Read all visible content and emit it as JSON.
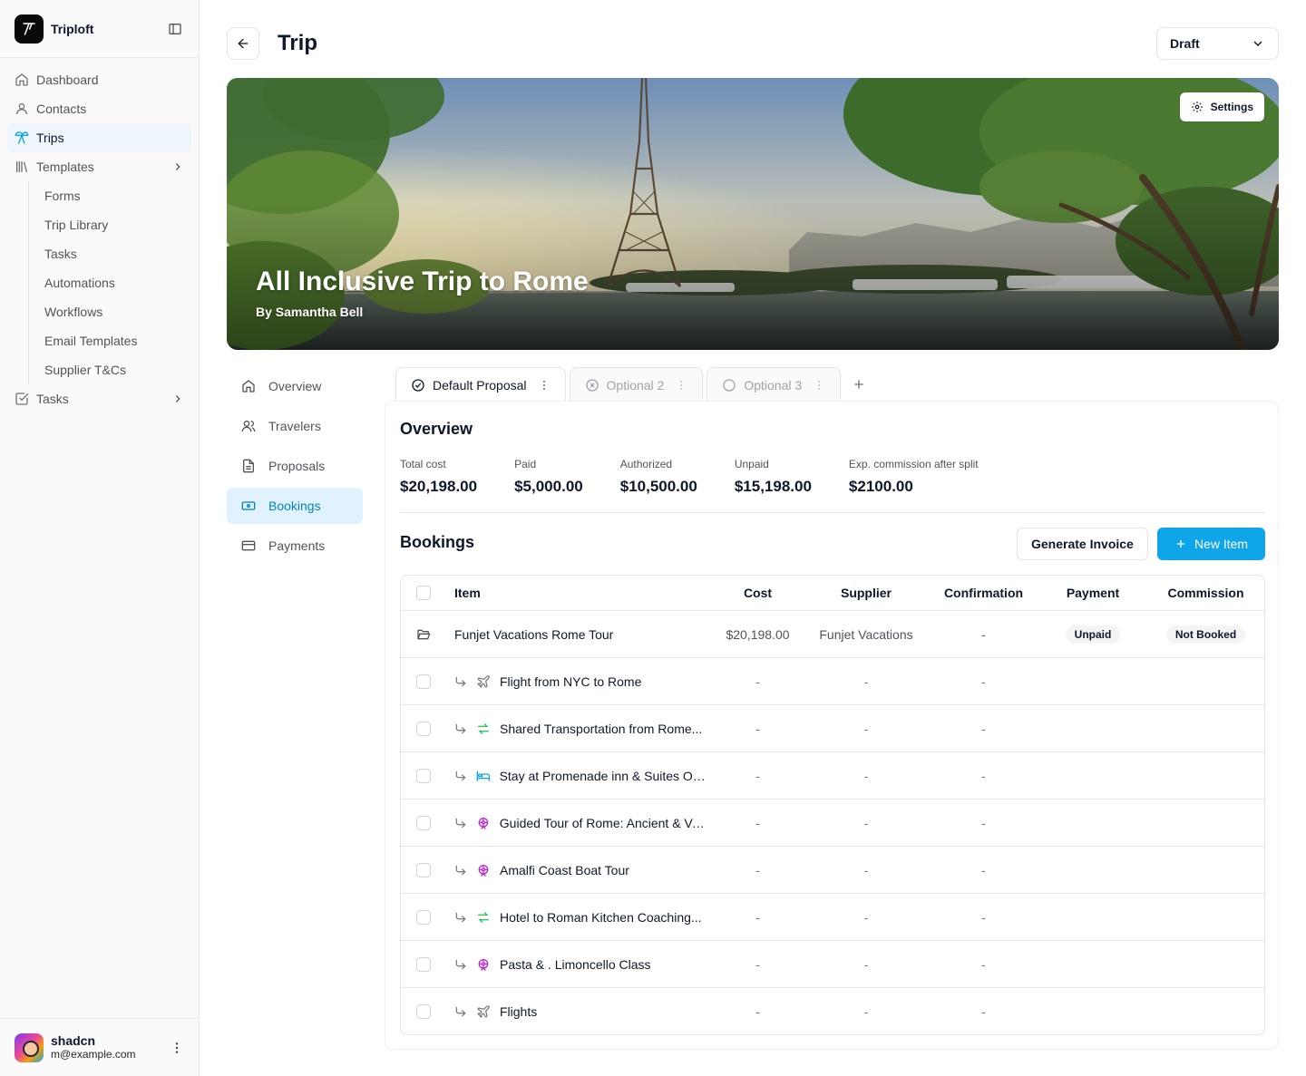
{
  "app": {
    "name": "Triploft"
  },
  "sidebar": {
    "items": [
      {
        "label": "Dashboard",
        "icon": "home-icon"
      },
      {
        "label": "Contacts",
        "icon": "user-icon"
      },
      {
        "label": "Trips",
        "icon": "palm-tree-icon",
        "active": true
      },
      {
        "label": "Templates",
        "icon": "library-icon"
      }
    ],
    "sub_items": [
      "Forms",
      "Trip Library",
      "Tasks",
      "Automations",
      "Workflows",
      "Email Templates",
      "Supplier T&Cs"
    ],
    "tasks": {
      "label": "Tasks",
      "icon": "check-square-icon"
    }
  },
  "user": {
    "name": "shadcn",
    "email": "m@example.com"
  },
  "header": {
    "title": "Trip",
    "status": "Draft"
  },
  "hero": {
    "title": "All Inclusive Trip to Rome",
    "author": "By Samantha Bell",
    "settings_label": "Settings"
  },
  "section_nav": [
    {
      "label": "Overview",
      "icon": "home-icon"
    },
    {
      "label": "Travelers",
      "icon": "users-icon"
    },
    {
      "label": "Proposals",
      "icon": "file-icon"
    },
    {
      "label": "Bookings",
      "icon": "ticket-icon",
      "active": true
    },
    {
      "label": "Payments",
      "icon": "credit-card-icon"
    }
  ],
  "tabs": [
    {
      "label": "Default Proposal",
      "active": true
    },
    {
      "label": "Optional 2"
    },
    {
      "label": "Optional 3"
    }
  ],
  "overview": {
    "title": "Overview",
    "stats": [
      {
        "label": "Total cost",
        "value": "$20,198.00"
      },
      {
        "label": "Paid",
        "value": "$5,000.00"
      },
      {
        "label": "Authorized",
        "value": "$10,500.00"
      },
      {
        "label": "Unpaid",
        "value": "$15,198.00"
      },
      {
        "label": "Exp. commission after split",
        "value": "$2100.00"
      }
    ]
  },
  "bookings": {
    "title": "Bookings",
    "generate_invoice_label": "Generate Invoice",
    "new_item_label": "New Item",
    "columns": {
      "item": "Item",
      "cost": "Cost",
      "supplier": "Supplier",
      "confirmation": "Confirmation",
      "payment": "Payment",
      "commission": "Commission"
    },
    "parent": {
      "item": "Funjet Vacations Rome Tour",
      "cost": "$20,198.00",
      "supplier": "Funjet Vacations",
      "confirmation": "-",
      "payment": "Unpaid",
      "commission": "Not Booked"
    },
    "rows": [
      {
        "item": "Flight from NYC to Rome",
        "type": "plane-icon",
        "cost": "-",
        "supplier": "-",
        "confirmation": "-"
      },
      {
        "item": "Shared Transportation from Rome...",
        "type": "transfer-icon",
        "cost": "-",
        "supplier": "-",
        "confirmation": "-"
      },
      {
        "item": "Stay at Promenade inn & Suites Ocea",
        "type": "bed-icon",
        "cost": "-",
        "supplier": "-",
        "confirmation": "-"
      },
      {
        "item": "Guided Tour of Rome: Ancient & Vatic",
        "type": "ferris-wheel-icon",
        "cost": "-",
        "supplier": "-",
        "confirmation": "-"
      },
      {
        "item": "Amalfi Coast Boat  Tour",
        "type": "ferris-wheel-icon",
        "cost": "-",
        "supplier": "-",
        "confirmation": "-"
      },
      {
        "item": "Hotel to Roman Kitchen Coaching...",
        "type": "transfer-icon",
        "cost": "-",
        "supplier": "-",
        "confirmation": "-"
      },
      {
        "item": "Pasta & . Limoncello Class",
        "type": "ferris-wheel-icon",
        "cost": "-",
        "supplier": "-",
        "confirmation": "-"
      },
      {
        "item": "Flights",
        "type": "plane-icon",
        "cost": "-",
        "supplier": "-",
        "confirmation": "-"
      }
    ]
  },
  "colors": {
    "accent": "#0ea5e9",
    "active_bg": "#e0f2fe",
    "transfer": "#22c55e",
    "activity": "#c026d3"
  }
}
